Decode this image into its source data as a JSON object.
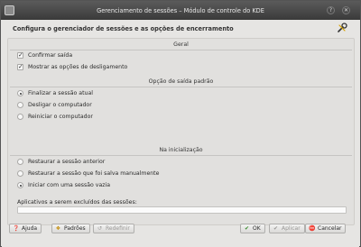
{
  "window": {
    "title": "Gerenciamento de sessões – Módulo de controle do KDE"
  },
  "header": {
    "text": "Configura o gerenciador de sessões e as opções de encerramento"
  },
  "groups": {
    "general": {
      "title": "Geral",
      "options": [
        {
          "label": "Confirmar saída",
          "checked": true
        },
        {
          "label": "Mostrar as opções de desligamento",
          "checked": true
        }
      ]
    },
    "default_exit": {
      "title": "Opção de saída padrão",
      "options": [
        {
          "label": "Finalizar a sessão atual",
          "selected": true
        },
        {
          "label": "Desligar o computador",
          "selected": false
        },
        {
          "label": "Reiniciar o computador",
          "selected": false
        }
      ]
    },
    "startup": {
      "title": "Na inicialização",
      "options": [
        {
          "label": "Restaurar a sessão anterior",
          "selected": false
        },
        {
          "label": "Restaurar a sessão que foi salva manualmente",
          "selected": false
        },
        {
          "label": "Iniciar com uma sessão vazia",
          "selected": true
        }
      ],
      "exclude_label": "Aplicativos a serem excluídos das sessões:",
      "exclude_value": ""
    }
  },
  "buttons": {
    "help": "Ajuda",
    "defaults": "Padrões",
    "reset": "Redefinir",
    "ok": "OK",
    "apply": "Aplicar",
    "cancel": "Cancelar"
  },
  "icons": {
    "app": "kde-app-icon",
    "help_window": "question-icon",
    "close_window": "close-icon",
    "header": "wrench-icon",
    "help": "help-icon",
    "defaults": "defaults-icon",
    "reset": "reset-icon",
    "ok": "check-icon",
    "apply": "apply-icon",
    "cancel": "cancel-icon"
  },
  "colors": {
    "titlebar": "#4a4a4a",
    "panel": "#e1e0de",
    "cancel_red": "#c0392b",
    "ok_green": "#3a8d2f"
  }
}
